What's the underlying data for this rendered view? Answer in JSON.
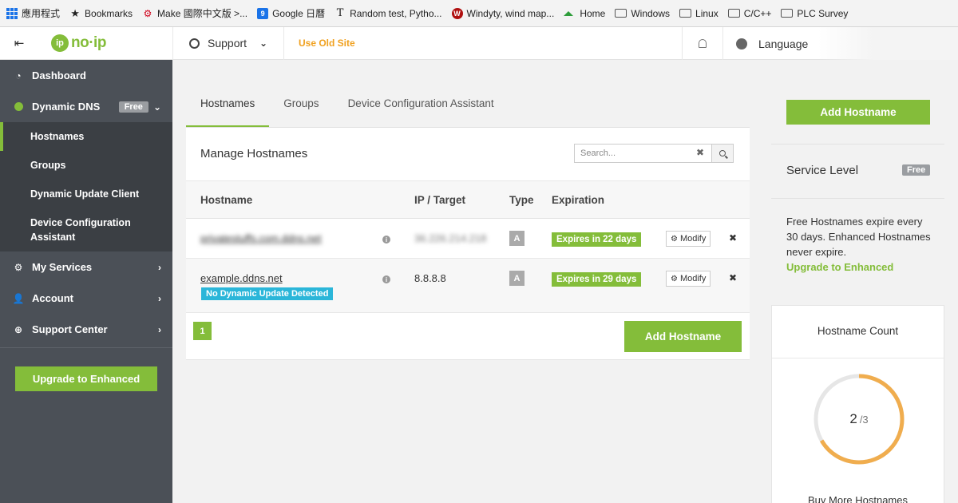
{
  "bookmarks": [
    {
      "label": "應用程式",
      "icon": "apps-icon"
    },
    {
      "label": "Bookmarks",
      "icon": "star-icon"
    },
    {
      "label": "Make 國際中文版 >...",
      "icon": "make-icon"
    },
    {
      "label": "Google 日曆",
      "icon": "google-calendar-icon"
    },
    {
      "label": "Random test, Pytho...",
      "icon": "t-icon"
    },
    {
      "label": "Windyty, wind map...",
      "icon": "windy-icon"
    },
    {
      "label": "Home",
      "icon": "home-icon"
    },
    {
      "label": "Windows",
      "icon": "folder-icon"
    },
    {
      "label": "Linux",
      "icon": "folder-icon"
    },
    {
      "label": "C/C++",
      "icon": "folder-icon"
    },
    {
      "label": "PLC Survey",
      "icon": "folder-icon"
    }
  ],
  "header": {
    "logo_text": "no·ip",
    "support_label": "Support",
    "old_site_label": "Use Old Site",
    "language_label": "Language"
  },
  "sidebar": {
    "dashboard": "Dashboard",
    "dynamic_dns": "Dynamic DNS",
    "dns_badge": "Free",
    "sub_items": [
      "Hostnames",
      "Groups",
      "Dynamic Update Client",
      "Device Configuration Assistant"
    ],
    "my_services": "My Services",
    "account": "Account",
    "support_center": "Support Center",
    "upgrade_button": "Upgrade to Enhanced"
  },
  "main": {
    "tabs": [
      "Hostnames",
      "Groups",
      "Device Configuration Assistant"
    ],
    "panel_title": "Manage Hostnames",
    "search_placeholder": "Search...",
    "columns": [
      "Hostname",
      "IP / Target",
      "Type",
      "Expiration"
    ],
    "rows": [
      {
        "hostname": "privatestuffs.com.ddns.net",
        "ip": "36.226.214.218",
        "type": "A",
        "expiration": "Expires in 22 days",
        "modify": "Modify",
        "blurred": true
      },
      {
        "hostname": "example.ddns.net",
        "ip": "8.8.8.8",
        "type": "A",
        "expiration": "Expires in 29 days",
        "modify": "Modify",
        "status": "No Dynamic Update Detected"
      }
    ],
    "page_number": "1",
    "add_hostname": "Add Hostname"
  },
  "right": {
    "add_hostname": "Add Hostname",
    "service_level_label": "Service Level",
    "service_level_value": "Free",
    "note_text": "Free Hostnames expire every 30 days. Enhanced Hostnames never expire.",
    "upgrade_link": "Upgrade to Enhanced",
    "count_title": "Hostname Count",
    "count_used": 2,
    "count_total": "/3",
    "buy_more": "Buy More Hostnames"
  },
  "colors": {
    "brand_green": "#84bd3a",
    "sidebar_bg": "#4b5057",
    "info_blue": "#2bb6d9",
    "ring_orange": "#f0ad4e",
    "old_site_orange": "#f0a01e"
  }
}
